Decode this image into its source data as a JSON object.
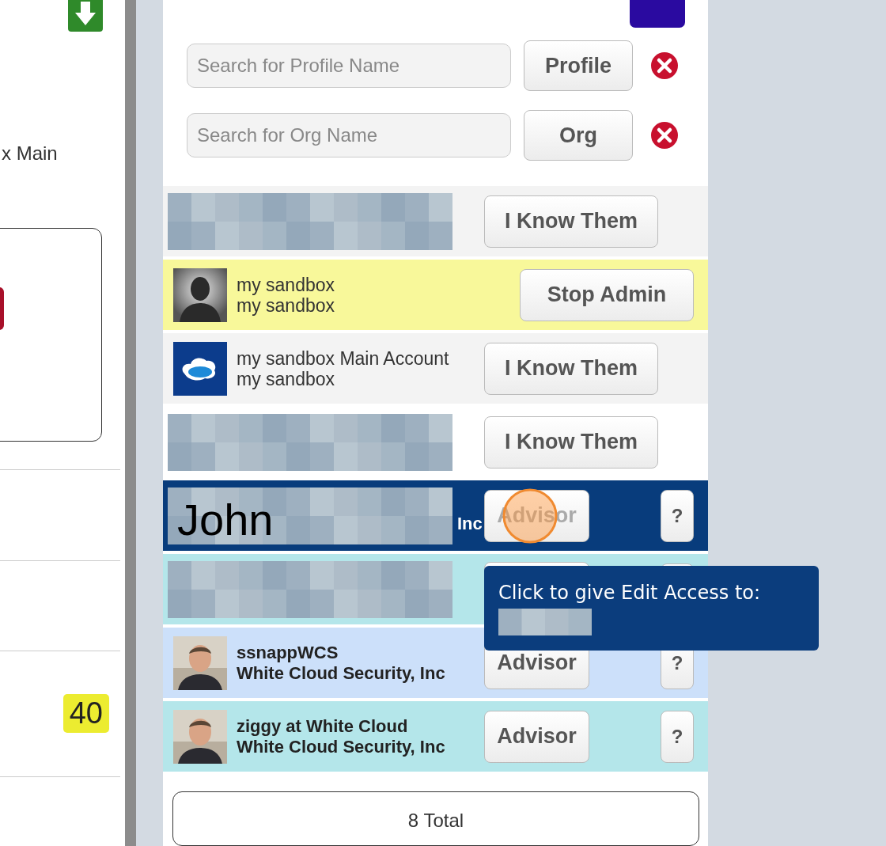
{
  "left_panel": {
    "label": "x Main",
    "badge": "40"
  },
  "main": {
    "search": [
      {
        "placeholder": "Search for Profile Name",
        "button": "Profile"
      },
      {
        "placeholder": "Search for Org Name",
        "button": "Org"
      }
    ],
    "rows": [
      {
        "kind": "contact",
        "color": "#f3f3f3",
        "selected": false,
        "image": {
          "kind": "redacted"
        },
        "action": {
          "label": "I Know Them",
          "disabled": false
        }
      },
      {
        "kind": "admin",
        "color": "#f8f89a",
        "selected": false,
        "image": {
          "kind": "silhouette"
        },
        "lines": [
          "my sandbox",
          "my sandbox"
        ],
        "action": {
          "label": "Stop Admin",
          "disabled": false
        }
      },
      {
        "kind": "contact",
        "color": "#f3f3f3",
        "selected": false,
        "image": {
          "kind": "cloud"
        },
        "lines": [
          "my sandbox Main Account",
          "my sandbox"
        ],
        "action": {
          "label": "I Know Them",
          "disabled": false
        }
      },
      {
        "kind": "contact",
        "color": "#ffffff",
        "selected": false,
        "image": {
          "kind": "redacted"
        },
        "action": {
          "label": "I Know Them",
          "disabled": false
        }
      },
      {
        "kind": "advisor",
        "selected": true,
        "clicked": true,
        "image": {
          "kind": "redacted",
          "overlay": "John"
        },
        "lines": [
          "Inc"
        ],
        "action": {
          "label": "Advisor",
          "disabled": true
        },
        "help": "?"
      },
      {
        "kind": "advisor",
        "color": "#b4e6ea",
        "selected": false,
        "image": {
          "kind": "redacted"
        }
      },
      {
        "kind": "advisor",
        "color": "#cce0fa",
        "selected": false,
        "lines": [
          "ssnappWCS",
          "White Cloud Security, Inc"
        ],
        "action": {
          "label": "Advisor",
          "disabled": false
        },
        "help": "?"
      },
      {
        "kind": "advisor",
        "color": "#b4e6ea",
        "selected": false,
        "lines": [
          "ziggy at White Cloud",
          "White Cloud Security, Inc"
        ],
        "action": {
          "label": "Advisor",
          "disabled": false
        },
        "help": "?"
      }
    ],
    "total": "8 Total"
  },
  "tooltip": {
    "text": "Click to give Edit Access to:"
  }
}
